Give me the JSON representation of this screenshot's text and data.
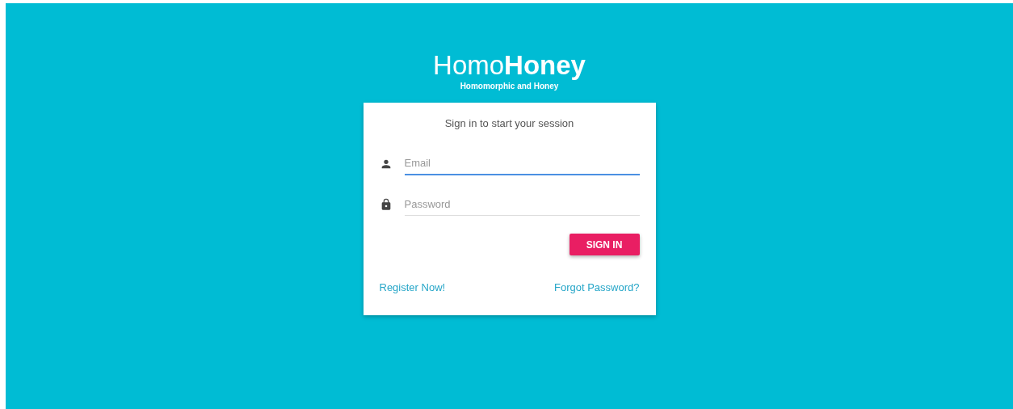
{
  "logo": {
    "title": "Homo**Honey**",
    "subtitle": "Homomorphic and Honey"
  },
  "card": {
    "heading": "Sign in to start your session",
    "fields": [
      {
        "kind": "email",
        "placeholder": "Email",
        "focused": true
      },
      {
        "kind": "password",
        "placeholder": "Password",
        "focused": false
      }
    ],
    "button": "SIGN IN",
    "links": [
      "Register Now!",
      "Forgot Password?"
    ]
  }
}
